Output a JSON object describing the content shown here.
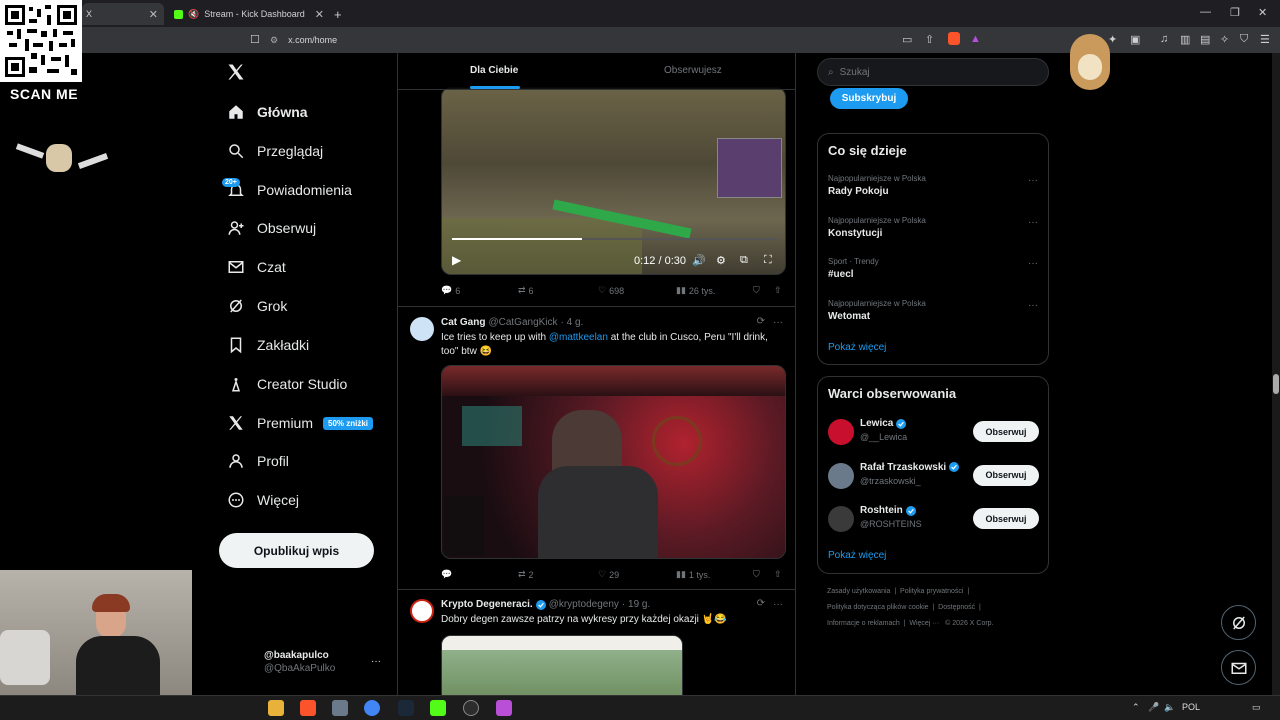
{
  "browser": {
    "tabs": [
      {
        "label": "X",
        "active": true
      },
      {
        "label": "Stream - Kick Dashboard",
        "active": false
      }
    ],
    "new_tab": "+",
    "url": "x.com/home"
  },
  "overlay": {
    "scan_me": "SCAN ME"
  },
  "nav": {
    "items": [
      {
        "label": "Główna",
        "icon": "home-icon"
      },
      {
        "label": "Przeglądaj",
        "icon": "search-icon"
      },
      {
        "label": "Powiadomienia",
        "icon": "bell-icon"
      },
      {
        "label": "Obserwuj",
        "icon": "follow-icon"
      },
      {
        "label": "Czat",
        "icon": "mail-icon"
      },
      {
        "label": "Grok",
        "icon": "grok-icon"
      },
      {
        "label": "Zakładki",
        "icon": "bookmark-icon"
      },
      {
        "label": "Creator Studio",
        "icon": "creator-icon"
      },
      {
        "label": "Premium",
        "icon": "x-icon"
      },
      {
        "label": "Profil",
        "icon": "profile-icon"
      },
      {
        "label": "Więcej",
        "icon": "more-icon"
      }
    ],
    "notifications_badge": "20+",
    "premium_promo": "50% zniżki",
    "post_button": "Opublikuj wpis",
    "account_name": "@baakapulco",
    "account_handle": "@QbaAkaPulko",
    "account_more": "···"
  },
  "feed": {
    "tabs": [
      "Dla Ciebie",
      "Obserwujesz"
    ],
    "video1": {
      "time": "0:12 / 0:30",
      "replies": "6",
      "reposts": "6",
      "likes": "698",
      "views": "26 tys."
    },
    "tweet2": {
      "name": "Cat Gang",
      "handle": "@CatGangKick",
      "time": "· 4 g.",
      "text_before": "Ice tries to keep up with ",
      "mention": "@mattkeelan",
      "text_after": " at the club in Cusco, Peru \"I'll drink, too\" btw 😆",
      "replies": "",
      "reposts": "2",
      "likes": "29",
      "views": "1 tys."
    },
    "tweet3": {
      "name": "Krypto Degeneraci.",
      "handle": "@kryptodegeny",
      "time": "· 19 g.",
      "text": "Dobry degen zawsze patrzy na wykresy przy każdej okazji 🤘😂"
    }
  },
  "sidebar": {
    "search_placeholder": "Szukaj",
    "subscribe": "Subskrybuj",
    "trends_title": "Co się dzieje",
    "trends": [
      {
        "category": "Najpopularniejsze w Polska",
        "name": "Rady Pokoju"
      },
      {
        "category": "Najpopularniejsze w Polska",
        "name": "Konstytucji"
      },
      {
        "category": "Sport · Trendy",
        "name": "#uecl"
      },
      {
        "category": "Najpopularniejsze w Polska",
        "name": "Wetomat"
      }
    ],
    "trends_more": "Pokaż więcej",
    "who_title": "Warci obserwowania",
    "who": [
      {
        "name": "Lewica",
        "handle": "@__Lewica",
        "button": "Obserwuj"
      },
      {
        "name": "Rafał Trzaskowski",
        "handle": "@trzaskowski_",
        "button": "Obserwuj"
      },
      {
        "name": "Roshtein",
        "handle": "@ROSHTEINS",
        "button": "Obserwuj"
      }
    ],
    "who_more": "Pokaż więcej",
    "footer_line1": [
      "Zasady użytkowania",
      "|",
      "Polityka prywatności",
      "|"
    ],
    "footer_line2": [
      "Polityka dotycząca plików cookie",
      "|",
      "Dostępność",
      "|"
    ],
    "footer_line3": [
      "Informacje o reklamach",
      "|",
      "Więcej ···",
      "© 2026 X Corp."
    ]
  },
  "taskbar": {
    "lang": "POL"
  },
  "colors": {
    "accent": "#1d9bf0",
    "background": "#000000",
    "border": "#2f3336",
    "muted": "#71767b"
  }
}
